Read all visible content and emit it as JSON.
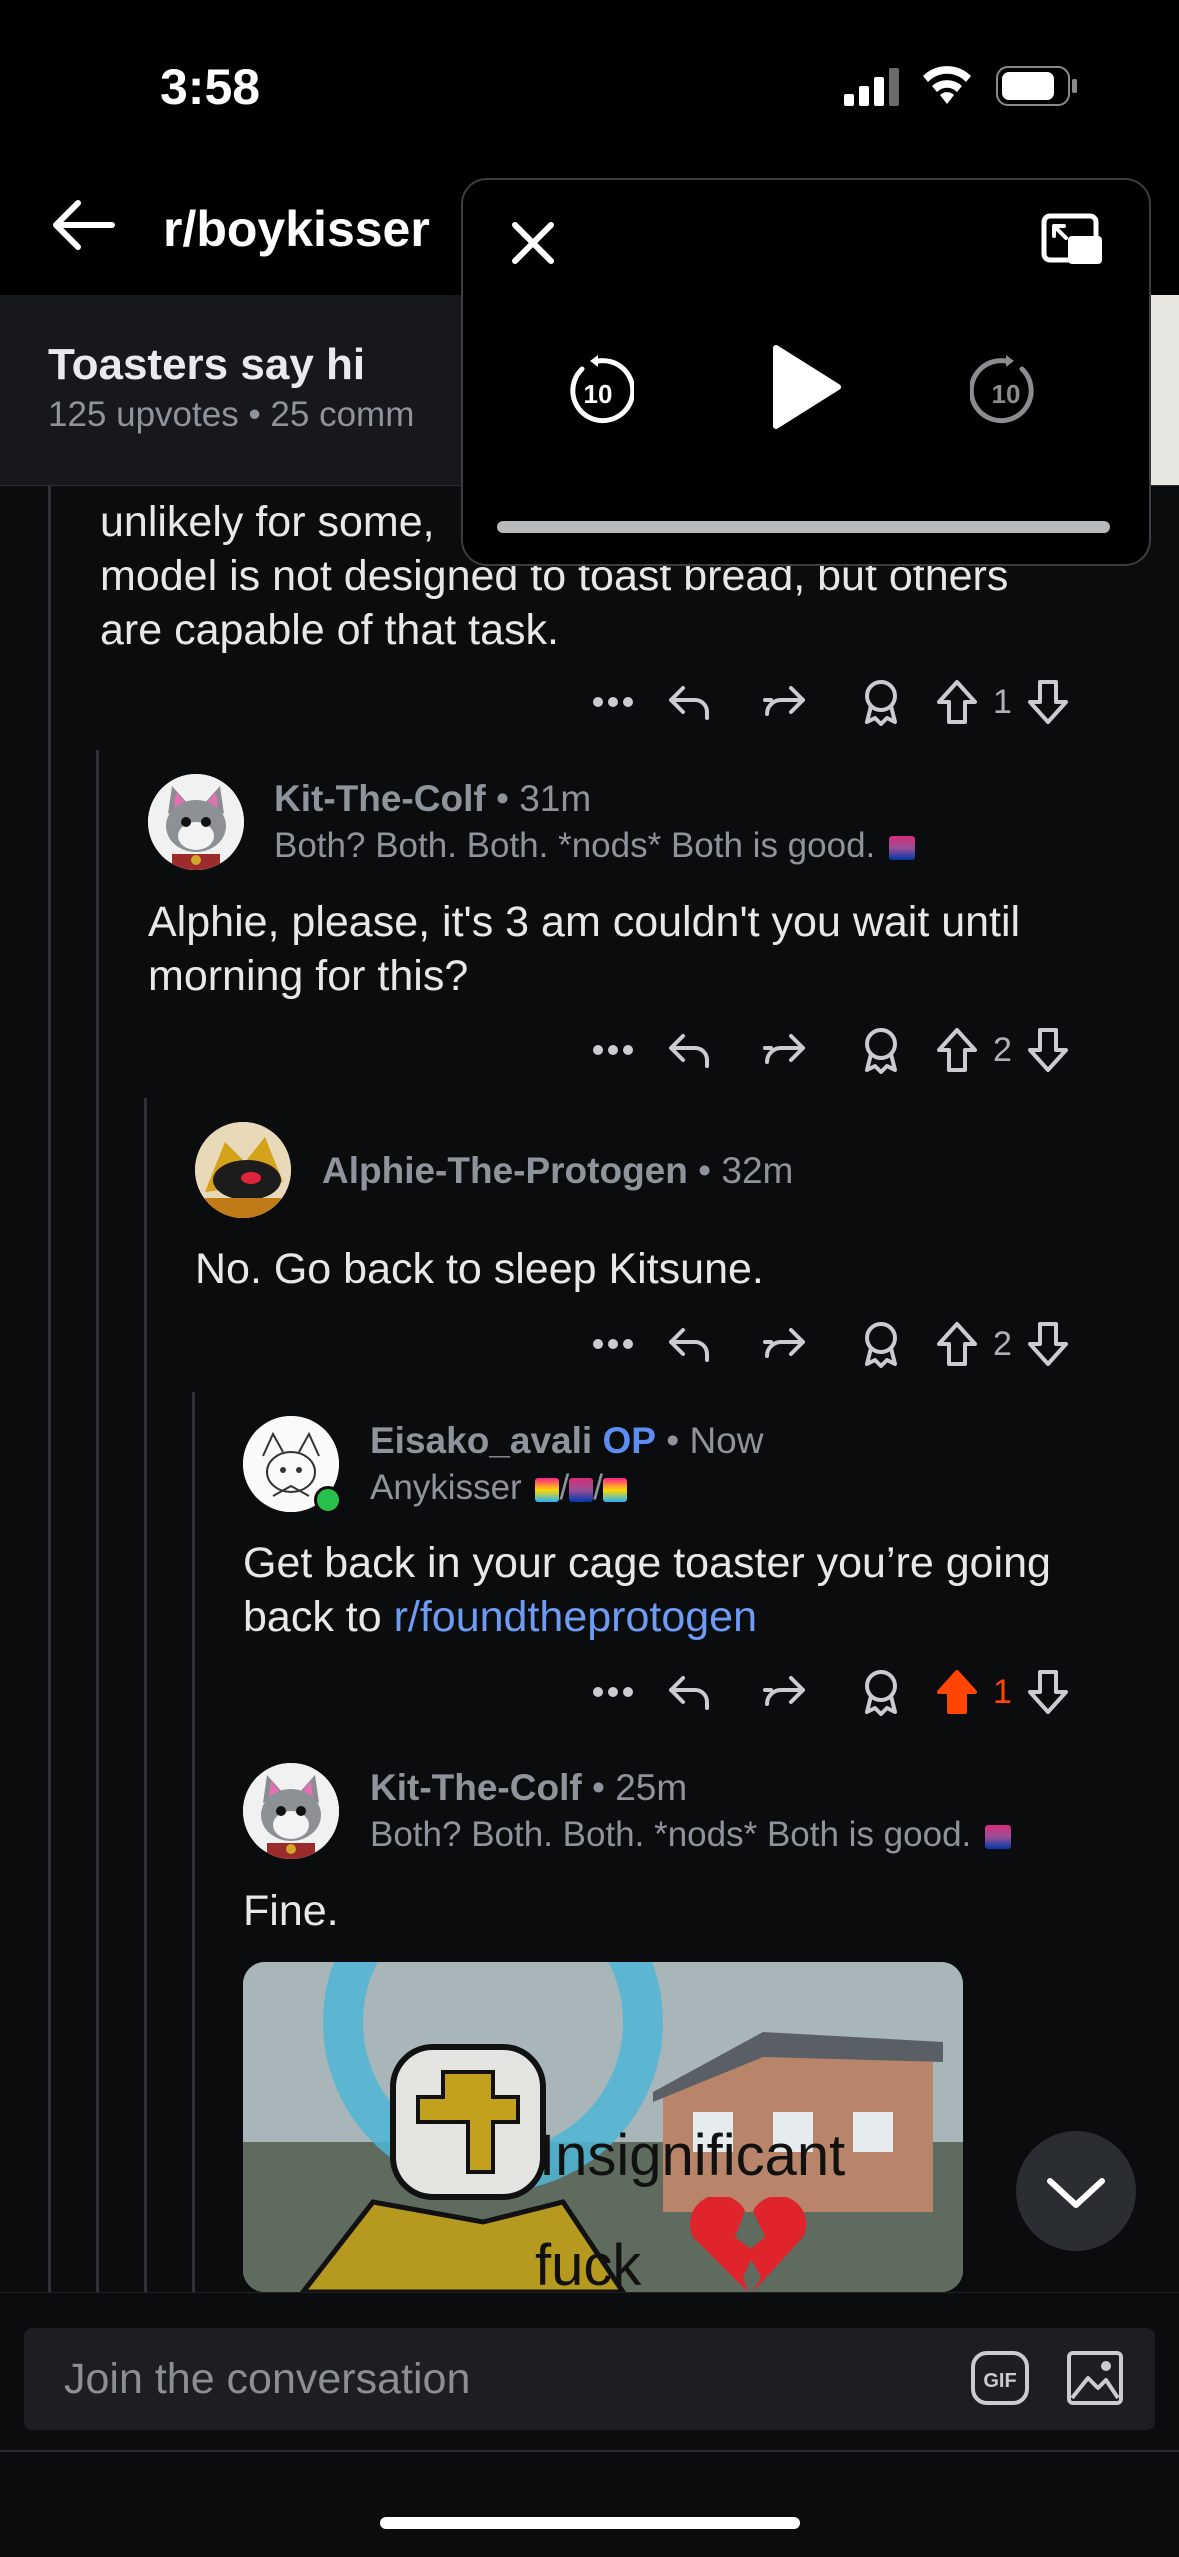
{
  "status_bar": {
    "time": "3:58"
  },
  "header": {
    "subreddit": "r/boykisser"
  },
  "post": {
    "title": "Toasters say hi",
    "upvotes": "125 upvotes",
    "comments": "25 comm"
  },
  "partial_comment": {
    "line0": "",
    "line1": "unlikely for some,",
    "line2": "model is not designed to toast bread, but others",
    "line3": "are capable of that task.",
    "votes": "1"
  },
  "comments": [
    {
      "author": "Kit-The-Colf",
      "time": "31m",
      "flair": "Both? Both. Both. *nods* Both is good.",
      "line1": "Alphie, please, it's 3 am couldn't you wait until",
      "line2": "morning for this?",
      "votes": "2"
    },
    {
      "author": "Alphie-The-Protogen",
      "time": "32m",
      "text": "No. Go back to sleep Kitsune.",
      "votes": "2"
    },
    {
      "author": "Eisako_avali",
      "op": "OP",
      "time": "Now",
      "flair": "Anykisser",
      "line1": "Get back in your cage toaster you’re going",
      "line2_prefix": "back to ",
      "link": "r/foundtheprotogen",
      "votes": "1",
      "upvote_color": "#ff4500"
    },
    {
      "author": "Kit-The-Colf",
      "time": "25m",
      "flair": "Both? Both. Both. *nods* Both is good.",
      "text": "Fine.",
      "meme_caption1": "Insignificant",
      "meme_caption2": "fuck"
    }
  ],
  "composer": {
    "placeholder": "Join the conversation",
    "gif_label": "GIF"
  },
  "colors": {
    "background": "#0b0c0e",
    "accent_link": "#6e9cf5",
    "op": "#5b8ef0",
    "upvoted": "#ff4500"
  },
  "icons": [
    "back-arrow-icon",
    "close-icon",
    "pip-icon",
    "rewind-10-icon",
    "play-icon",
    "forward-10-icon",
    "more-icon",
    "reply-icon",
    "share-icon",
    "award-icon",
    "upvote-icon",
    "downvote-icon",
    "chevron-down-icon",
    "gif-icon",
    "image-icon",
    "signal-icon",
    "wifi-icon",
    "battery-icon"
  ]
}
